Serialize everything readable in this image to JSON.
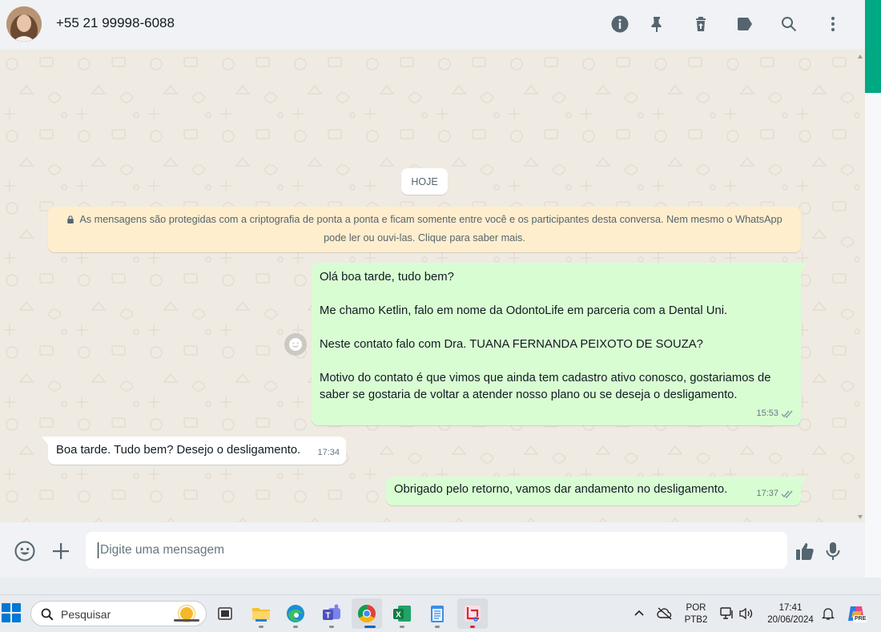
{
  "header": {
    "contact_name": "+55 21 99998-6088",
    "icons": [
      "info-icon",
      "pin-icon",
      "delete-icon",
      "label-icon",
      "search-icon",
      "menu-icon"
    ]
  },
  "chat": {
    "day_label": "HOJE",
    "encryption_notice": "As mensagens são protegidas com a criptografia de ponta a ponta e ficam somente entre você e os participantes desta conversa. Nem mesmo o WhatsApp pode ler ou ouvi-las. Clique para saber mais.",
    "messages": [
      {
        "direction": "outgoing",
        "lines": [
          "Olá boa tarde, tudo bem?",
          "",
          "Me chamo Ketlin, falo em nome da OdontoLife em parceria com a Dental Uni.",
          "",
          "Neste contato falo com Dra. TUANA FERNANDA PEIXOTO DE SOUZA?",
          "",
          "Motivo do contato é que vimos que ainda tem cadastro ativo conosco, gostariamos de saber se gostaria de voltar a atender nosso plano ou se deseja o desligamento."
        ],
        "time": "15:53",
        "status": "read"
      },
      {
        "direction": "incoming",
        "text": "Boa tarde. Tudo bem? Desejo o desligamento.",
        "time": "17:34"
      },
      {
        "direction": "outgoing",
        "text": "Obrigado pelo retorno, vamos dar andamento no desligamento.",
        "time": "17:37",
        "status": "read"
      }
    ]
  },
  "composer": {
    "placeholder": "Digite uma mensagem",
    "value": ""
  },
  "taskbar": {
    "search_placeholder": "Pesquisar",
    "apps": [
      "file-explorer",
      "edge",
      "teams",
      "chrome",
      "excel",
      "notepad",
      "snipping-tool"
    ],
    "language": "POR",
    "layout": "PTB2",
    "time": "17:41",
    "date": "20/06/2024",
    "copilot_badge": "PRE"
  },
  "colors": {
    "outgoing_bubble": "#d9fdd3",
    "incoming_bubble": "#ffffff",
    "chat_background": "#efeae2",
    "notice_background": "#ffeecd",
    "accent": "#00a884",
    "read_ticks": "#8696a0"
  }
}
